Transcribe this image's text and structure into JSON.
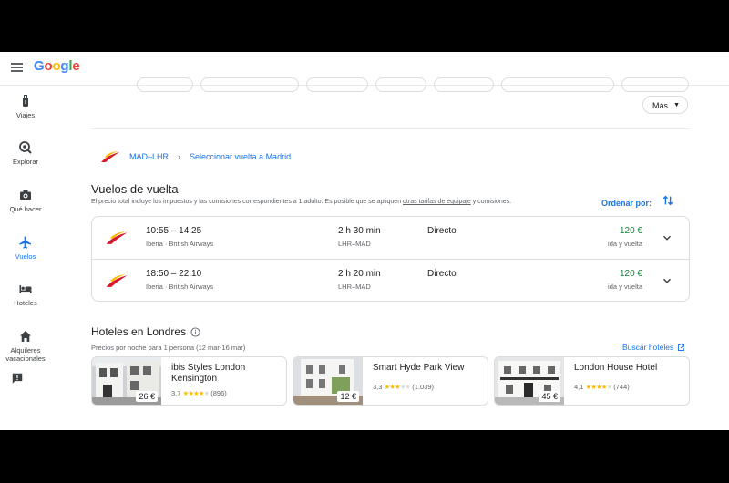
{
  "app": {
    "logo": "Google"
  },
  "sidebar": {
    "items": [
      {
        "label": "Viajes",
        "icon": "luggage-icon"
      },
      {
        "label": "Explorar",
        "icon": "explore-icon"
      },
      {
        "label": "Qué hacer",
        "icon": "camera-icon"
      },
      {
        "label": "Vuelos",
        "icon": "airplane-icon",
        "active": true
      },
      {
        "label": "Hoteles",
        "icon": "bed-icon"
      },
      {
        "label": "Alquileres vacacionales",
        "icon": "house-icon"
      }
    ],
    "feedback_icon": "feedback-icon"
  },
  "filters": {
    "more_label": "Más"
  },
  "breadcrumb": {
    "route": "MAD–LHR",
    "step": "Seleccionar vuelta a Madrid"
  },
  "return_flights": {
    "title": "Vuelos de vuelta",
    "note_pre": "El precio total incluye los impuestos y las comisiones correspondientes a 1 adulto. Es posible que se apliquen ",
    "note_link": "otras tarifas de equipaje",
    "note_post": " y comisiones.",
    "sort_label": "Ordenar por:",
    "flights": [
      {
        "times": "10:55 – 14:25",
        "airlines": "Iberia · British Airways",
        "duration": "2 h 30 min",
        "route": "LHR–MAD",
        "stops": "Directo",
        "price": "120 €",
        "price_type": "ida y vuelta"
      },
      {
        "times": "18:50 – 22:10",
        "airlines": "Iberia · British Airways",
        "duration": "2 h 20 min",
        "route": "LHR–MAD",
        "stops": "Directo",
        "price": "120 €",
        "price_type": "ida y vuelta"
      }
    ]
  },
  "hotels": {
    "title": "Hoteles en Londres",
    "note": "Precios por noche para 1 persona (12 mar-16 mar)",
    "search_label": "Buscar hoteles",
    "items": [
      {
        "name": "ibis Styles London Kensington",
        "price": "26 €",
        "rating": "3,7",
        "stars": 3.7,
        "reviews": "(896)"
      },
      {
        "name": "Smart Hyde Park View",
        "price": "12 €",
        "rating": "3,3",
        "stars": 3.3,
        "reviews": "(1.039)"
      },
      {
        "name": "London House Hotel",
        "price": "45 €",
        "rating": "4,1",
        "stars": 4.1,
        "reviews": "(744)"
      }
    ]
  },
  "colors": {
    "accent": "#1a73e8",
    "price": "#188038",
    "iberia_red": "#d7192d",
    "iberia_yellow": "#fbb900"
  }
}
